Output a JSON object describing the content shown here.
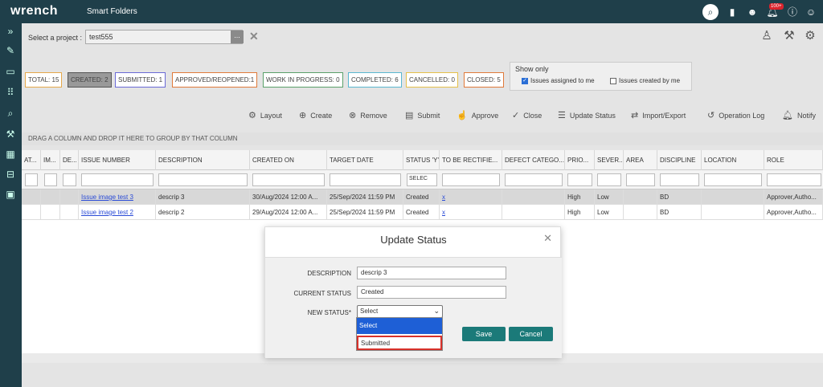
{
  "app": {
    "logo": "wrench",
    "section": "Smart Folders",
    "notif_badge": "100+"
  },
  "project": {
    "label": "Select a project :",
    "value": "test555",
    "browse_label": "..."
  },
  "stats": [
    {
      "label": "TOTAL: 15",
      "color": "#e5a84a"
    },
    {
      "label": "CREATED: 2",
      "color": "#555555"
    },
    {
      "label": "SUBMITTED: 1",
      "color": "#6a6ad6"
    },
    {
      "label": "APPROVED/REOPENED:1",
      "color": "#e07a3a"
    },
    {
      "label": "WORK IN PROGRESS: 0",
      "color": "#5aa06a"
    },
    {
      "label": "COMPLETED: 6",
      "color": "#5ab7d0"
    },
    {
      "label": "CANCELLED: 0",
      "color": "#e5c04a"
    },
    {
      "label": "CLOSED: 5",
      "color": "#e07a3a"
    }
  ],
  "show_only": {
    "title": "Show only",
    "assigned": "Issues assigned to me",
    "created": "Issues created by me"
  },
  "toolbar": [
    "Layout",
    "Create",
    "Remove",
    "Submit",
    "Approve",
    "Close",
    "Update Status",
    "Import/Export",
    "Operation Log",
    "Notify"
  ],
  "group_hint": "DRAG A COLUMN AND DROP IT HERE TO GROUP BY THAT COLUMN",
  "columns": [
    "AT...",
    "IM...",
    "DE...",
    "ISSUE NUMBER",
    "DESCRIPTION",
    "CREATED ON",
    "TARGET DATE",
    "STATUS 'Y'",
    "TO BE RECTIFIE...",
    "DEFECT CATEGO...",
    "PRIO...",
    "SEVER...",
    "AREA",
    "DISCIPLINE",
    "LOCATION",
    "ROLE"
  ],
  "filter_select": "SELEC",
  "rows": [
    {
      "issue": "Issue image test 3",
      "desc": "descrip 3",
      "created": "30/Aug/2024 12:00 A...",
      "target": "25/Sep/2024 11:59 PM",
      "status": "Created",
      "rect": "x",
      "prio": "High",
      "sev": "Low",
      "disc": "BD",
      "role": "Approver,Autho..."
    },
    {
      "issue": "Issue image test 2",
      "desc": "descrip 2",
      "created": "29/Aug/2024 12:00 A...",
      "target": "25/Sep/2024 11:59 PM",
      "status": "Created",
      "rect": "x",
      "prio": "High",
      "sev": "Low",
      "disc": "BD",
      "role": "Approver,Autho..."
    }
  ],
  "modal": {
    "title": "Update Status",
    "description_label": "DESCRIPTION",
    "description_value": "descrip 3",
    "current_label": "CURRENT STATUS",
    "current_value": "Created",
    "new_label": "NEW STATUS*",
    "new_value": "Select",
    "options": [
      "Select",
      "Submitted"
    ],
    "save": "Save",
    "cancel": "Cancel"
  }
}
